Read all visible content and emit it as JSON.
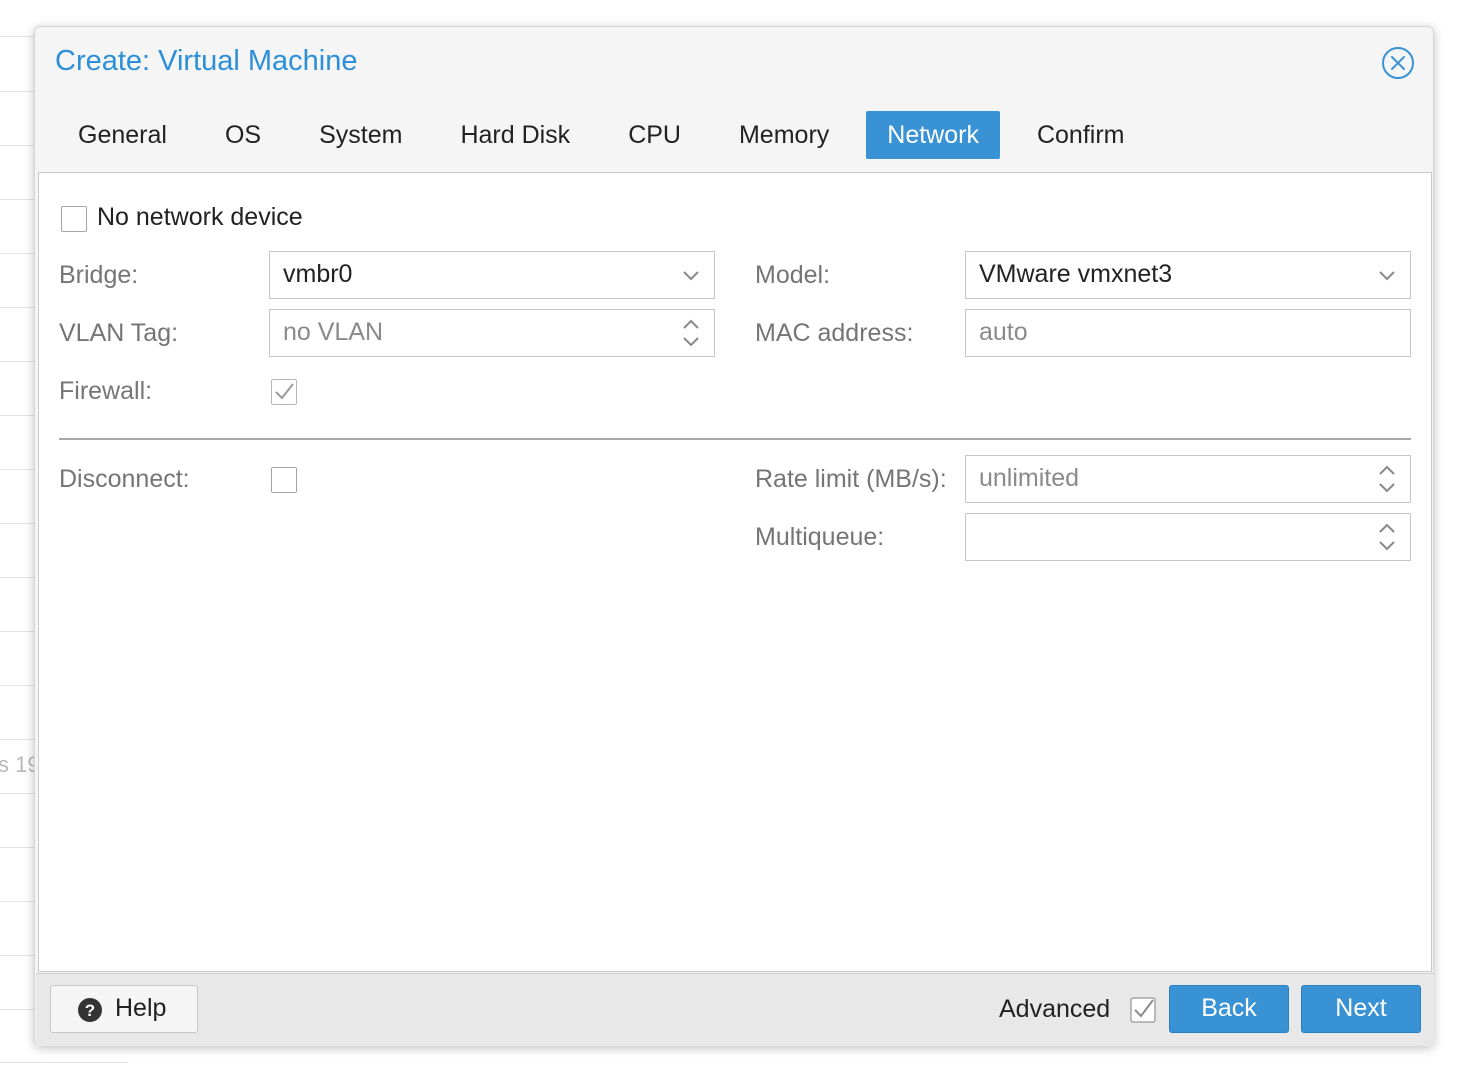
{
  "background": {
    "partial_text": "s 19"
  },
  "dialog": {
    "title": "Create: Virtual Machine",
    "close_icon": "close-circle-icon"
  },
  "tabs": [
    {
      "label": "General",
      "active": false
    },
    {
      "label": "OS",
      "active": false
    },
    {
      "label": "System",
      "active": false
    },
    {
      "label": "Hard Disk",
      "active": false
    },
    {
      "label": "CPU",
      "active": false
    },
    {
      "label": "Memory",
      "active": false
    },
    {
      "label": "Network",
      "active": true
    },
    {
      "label": "Confirm",
      "active": false
    }
  ],
  "form": {
    "no_network_device": {
      "label": "No network device",
      "checked": false
    },
    "bridge": {
      "label": "Bridge:",
      "value": "vmbr0"
    },
    "vlan_tag": {
      "label": "VLAN Tag:",
      "placeholder": "no VLAN"
    },
    "firewall": {
      "label": "Firewall:",
      "checked": true
    },
    "model": {
      "label": "Model:",
      "value": "VMware vmxnet3"
    },
    "mac_address": {
      "label": "MAC address:",
      "placeholder": "auto"
    },
    "disconnect": {
      "label": "Disconnect:",
      "checked": false
    },
    "rate_limit": {
      "label": "Rate limit (MB/s):",
      "placeholder": "unlimited"
    },
    "multiqueue": {
      "label": "Multiqueue:",
      "value": ""
    }
  },
  "footer": {
    "help_label": "Help",
    "advanced_label": "Advanced",
    "advanced_checked": true,
    "back_label": "Back",
    "next_label": "Next"
  },
  "colors": {
    "accent": "#3892d4",
    "title": "#2c8fd7",
    "label_muted": "#757575"
  }
}
